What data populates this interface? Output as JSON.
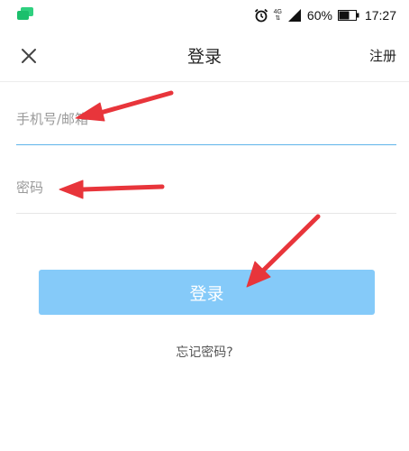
{
  "status_bar": {
    "network": "4G",
    "battery_percent": "60%",
    "time": "17:27",
    "icons": [
      "chat-app-icon",
      "alarm-icon",
      "signal-icon",
      "battery-icon"
    ]
  },
  "header": {
    "title": "登录",
    "register_label": "注册",
    "close_icon": "close-icon"
  },
  "form": {
    "phone_placeholder": "手机号/邮箱",
    "phone_value": "",
    "password_placeholder": "密码",
    "password_value": "",
    "login_label": "登录",
    "forgot_label": "忘记密码?"
  },
  "colors": {
    "accent": "#5fb4ea",
    "button": "#85caf9",
    "annotation_arrow": "#e8353b"
  }
}
